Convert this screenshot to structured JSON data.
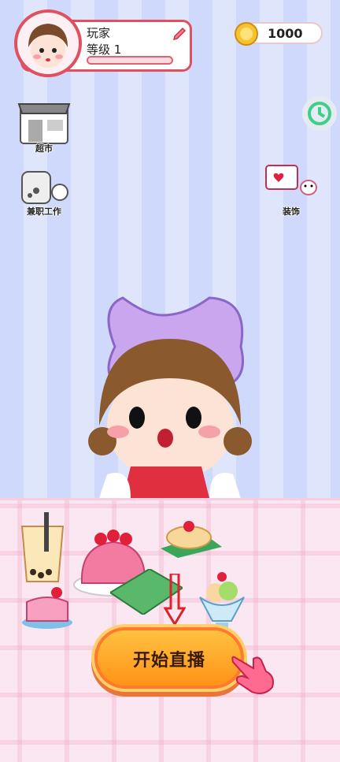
{
  "player": {
    "name": "玩家",
    "level_text": "等级 1",
    "xp_progress": 0
  },
  "currency": {
    "coins": "1000",
    "icon": "coin-icon"
  },
  "side_menu": {
    "left": [
      {
        "label": "超市",
        "icon": "supermarket-icon"
      },
      {
        "label": "兼职工作",
        "icon": "part-time-job-icon"
      }
    ],
    "right": [
      {
        "label": "装饰",
        "icon": "decoration-icon"
      },
      {
        "label": "",
        "icon": "game-center-icon"
      }
    ]
  },
  "main": {
    "start_button_label": "开始直播"
  },
  "colors": {
    "accent": "#e0505f",
    "button": "#ff9318",
    "sky_stripe_a": "#cfd9fb",
    "sky_stripe_b": "#dfe6fc",
    "floor": "#fbe7f1"
  }
}
